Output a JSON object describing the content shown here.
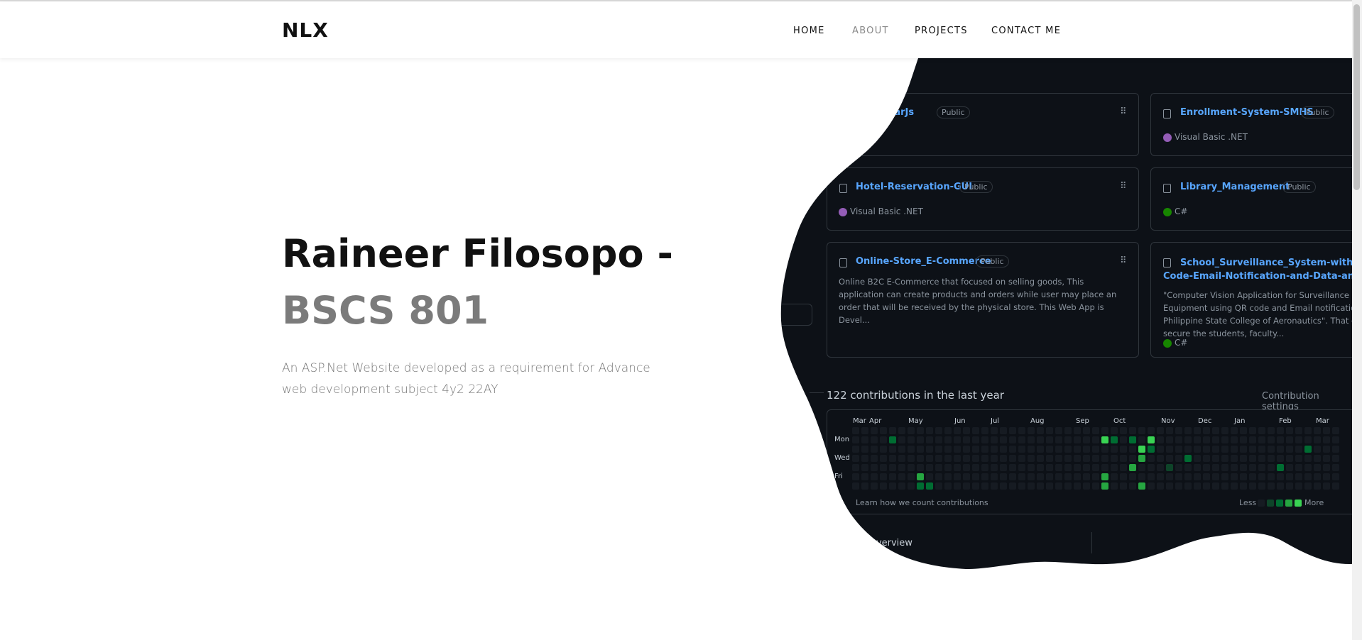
{
  "brand": "NLX",
  "nav": {
    "home": "HOME",
    "about": "ABOUT",
    "projects": "PROJECTS",
    "contact": "CONTACT ME"
  },
  "hero": {
    "title_line1": "Raineer Filosopo -",
    "title_line2": "BSCS 801",
    "description": "An ASP.Net Website developed as a requirement for Advance web development subject 4y2 22AY"
  },
  "github": {
    "public_label": "Public",
    "repos": [
      {
        "name": "AngularJs",
        "language": "",
        "description": ""
      },
      {
        "name": "Enrollment-System-SMHS",
        "language": "Visual Basic .NET",
        "description": ""
      },
      {
        "name": "Hotel-Reservation-GUI",
        "language": "Visual Basic .NET",
        "description": ""
      },
      {
        "name": "Library_Management",
        "language": "C#",
        "description": ""
      },
      {
        "name": "Online-Store_E-Commerce",
        "language": "",
        "description": "Online B2C E-Commerce that focused on selling goods, This application can create products and orders while user may place an order that will be received by the physical store. This Web App is Devel..."
      },
      {
        "name": "School_Surveillance_System-with-Face-QR-Code-Email-Notification-and-Data-anaytics",
        "language": "C#",
        "description": "\"Computer Vision Application for Surveillance Equipment using QR code and Email notification for Philippine State College of Aeronautics\". That can secure the students, faculty..."
      }
    ],
    "name_lines": {
      "r5a": "School_Surveillance_System-with-Face-QR-",
      "r5b": "Code-Email-Notification-and-Data-anaytics"
    },
    "lang_colors": {
      "Visual Basic .NET": "#945db7",
      "C#": "#178600"
    },
    "contributions_title": "122 contributions in the last year",
    "contribution_settings": "Contribution settings",
    "months": [
      "Mar",
      "Apr",
      "May",
      "Jun",
      "Jul",
      "Aug",
      "Sep",
      "Oct",
      "Nov",
      "Dec",
      "Jan",
      "Feb",
      "Mar"
    ],
    "days": [
      "Mon",
      "Wed",
      "Fri"
    ],
    "learn_link": "Learn how we count contributions",
    "legend_less": "Less",
    "legend_more": "More",
    "overview_label": "overview",
    "level_colors": [
      "#161b22",
      "#0e4429",
      "#006d32",
      "#26a641",
      "#39d353"
    ],
    "contrib_cells": [
      {
        "week": 4,
        "day": 1,
        "level": 2
      },
      {
        "week": 7,
        "day": 5,
        "level": 3
      },
      {
        "week": 7,
        "day": 6,
        "level": 2
      },
      {
        "week": 8,
        "day": 6,
        "level": 2
      },
      {
        "week": 27,
        "day": 1,
        "level": 4
      },
      {
        "week": 27,
        "day": 5,
        "level": 3
      },
      {
        "week": 27,
        "day": 6,
        "level": 3
      },
      {
        "week": 27,
        "day": 7,
        "level": 2
      },
      {
        "week": 28,
        "day": 1,
        "level": 2
      },
      {
        "week": 30,
        "day": 1,
        "level": 2
      },
      {
        "week": 30,
        "day": 4,
        "level": 3
      },
      {
        "week": 31,
        "day": 2,
        "level": 4
      },
      {
        "week": 31,
        "day": 3,
        "level": 3
      },
      {
        "week": 31,
        "day": 6,
        "level": 3
      },
      {
        "week": 31,
        "day": 7,
        "level": 4
      },
      {
        "week": 32,
        "day": 1,
        "level": 4
      },
      {
        "week": 32,
        "day": 2,
        "level": 2
      },
      {
        "week": 32,
        "day": 7,
        "level": 3
      },
      {
        "week": 34,
        "day": 4,
        "level": 1
      },
      {
        "week": 36,
        "day": 3,
        "level": 2
      },
      {
        "week": 46,
        "day": 4,
        "level": 2
      },
      {
        "week": 49,
        "day": 2,
        "level": 2
      }
    ]
  }
}
